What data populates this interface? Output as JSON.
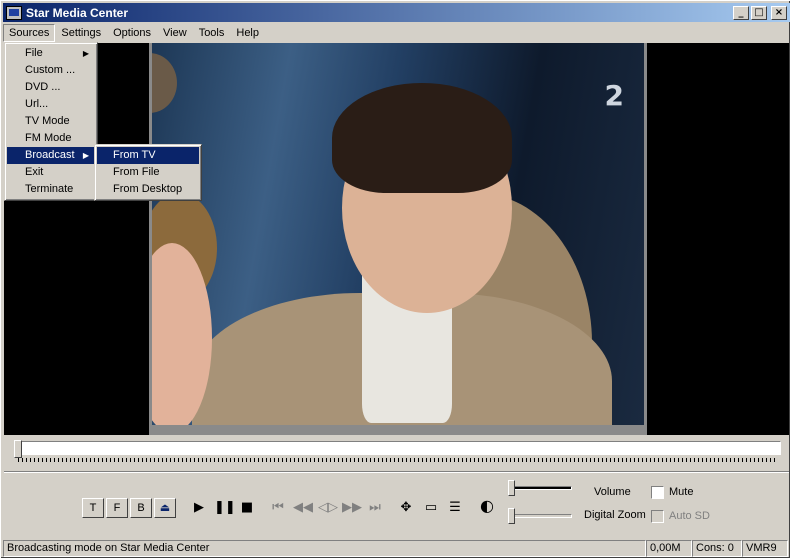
{
  "window": {
    "title": "Star Media Center"
  },
  "menubar": [
    "Sources",
    "Settings",
    "Options",
    "View",
    "Tools",
    "Help"
  ],
  "sources_menu": {
    "items": [
      "File",
      "Custom ...",
      "DVD ...",
      "Url...",
      "TV Mode",
      "FM Mode",
      "Broadcast",
      "Exit",
      "Terminate"
    ],
    "highlighted": "Broadcast"
  },
  "broadcast_submenu": {
    "items": [
      "From TV",
      "From File",
      "From Desktop"
    ],
    "highlighted": "From TV"
  },
  "video": {
    "channel_logo": "2"
  },
  "controls": {
    "t_label": "T",
    "f_label": "F",
    "b_label": "B",
    "volume_label": "Volume",
    "digital_zoom_label": "Digital Zoom",
    "mute_label": "Mute",
    "auto_sd_label": "Auto SD",
    "icons": {
      "eject": "eject-icon",
      "play": "play-icon",
      "pause": "pause-icon",
      "stop": "stop-icon",
      "first": "skip-first-icon",
      "rewind": "rewind-icon",
      "step": "step-icon",
      "forward": "fast-forward-icon",
      "last": "skip-last-icon",
      "move": "move-icon",
      "display": "monitor-icon",
      "playlist": "playlist-icon",
      "color": "color-adjust-icon"
    }
  },
  "status": {
    "message": "Broadcasting mode on Star Media Center",
    "size": "0,00M",
    "cons": "Cons: 0",
    "renderer": "VMR9"
  },
  "colors": {
    "titlebar": "#0a246a",
    "highlight": "#0a246a",
    "face": "#d4d0c8"
  }
}
